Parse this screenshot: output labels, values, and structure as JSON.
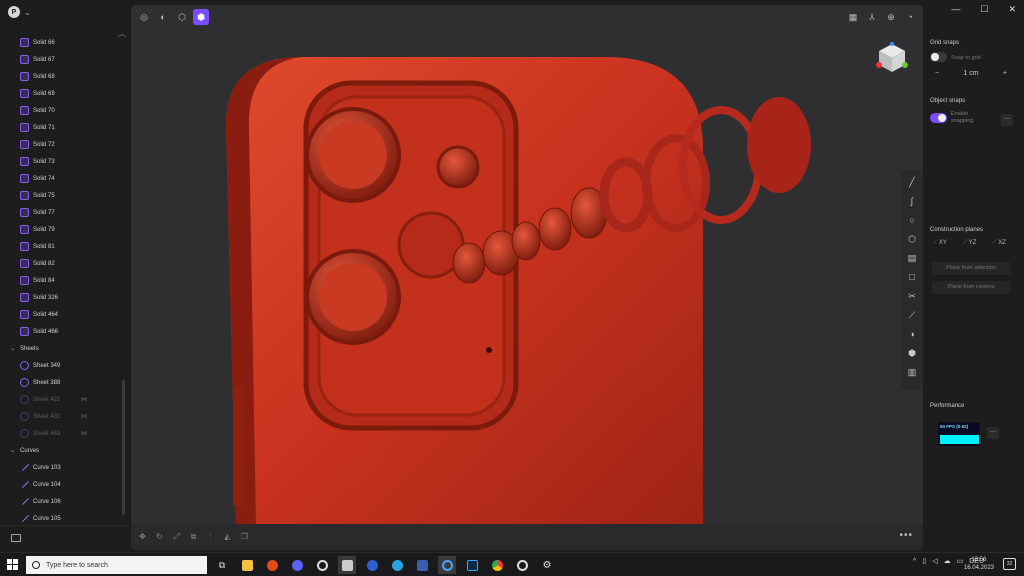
{
  "left_panel": {
    "avatar_letter": "P",
    "tree": [
      {
        "type": "solid",
        "label": "Solid 66"
      },
      {
        "type": "solid",
        "label": "Solid 67"
      },
      {
        "type": "solid",
        "label": "Solid 68"
      },
      {
        "type": "solid",
        "label": "Solid 69"
      },
      {
        "type": "solid",
        "label": "Solid 70"
      },
      {
        "type": "solid",
        "label": "Solid 71"
      },
      {
        "type": "solid",
        "label": "Solid 72"
      },
      {
        "type": "solid",
        "label": "Solid 73"
      },
      {
        "type": "solid",
        "label": "Solid 74"
      },
      {
        "type": "solid",
        "label": "Solid 75"
      },
      {
        "type": "solid",
        "label": "Solid 77"
      },
      {
        "type": "solid",
        "label": "Solid 79"
      },
      {
        "type": "solid",
        "label": "Solid 81"
      },
      {
        "type": "solid",
        "label": "Solid 82"
      },
      {
        "type": "solid",
        "label": "Solid 84"
      },
      {
        "type": "solid",
        "label": "Solid 326"
      },
      {
        "type": "solid",
        "label": "Solid 464"
      },
      {
        "type": "solid",
        "label": "Solid 466"
      }
    ],
    "sheets_group": "Sheets",
    "sheets": [
      {
        "label": "Sheet 349",
        "hidden": false
      },
      {
        "label": "Sheet 388",
        "hidden": false
      },
      {
        "label": "Sheet 421",
        "hidden": true
      },
      {
        "label": "Sheet 432",
        "hidden": true
      },
      {
        "label": "Sheet 463",
        "hidden": true
      }
    ],
    "curves_group": "Curves",
    "curves": [
      "Curve 103",
      "Curve 104",
      "Curve 106",
      "Curve 105"
    ]
  },
  "right_panel": {
    "grid_snaps_title": "Grid snaps",
    "snap_to_grid_label": "Snap to grid",
    "snap_to_grid_on": false,
    "grid_minus": "−",
    "grid_value": "1 cm",
    "grid_plus": "+",
    "object_snaps_title": "Object snaps",
    "enable_snapping_label": "Enable snapping",
    "enable_snapping_on": true,
    "more_label": "...",
    "construction_planes_title": "Construction planes",
    "planes": [
      "XY",
      "YZ",
      "XZ"
    ],
    "plane_from_selection": "Plane from selection",
    "plane_from_camera": "Plane from camera",
    "performance_title": "Performance",
    "fps_label": "60 FPS (0-62)"
  },
  "viewport": {
    "more_label": "•••",
    "accent_color": "#7c4dff",
    "model_color": "#c8321f"
  },
  "taskbar": {
    "search_placeholder": "Type here to search",
    "language": "DEU",
    "time": "13:56",
    "date": "16.04.2023",
    "notification_count": "32"
  }
}
